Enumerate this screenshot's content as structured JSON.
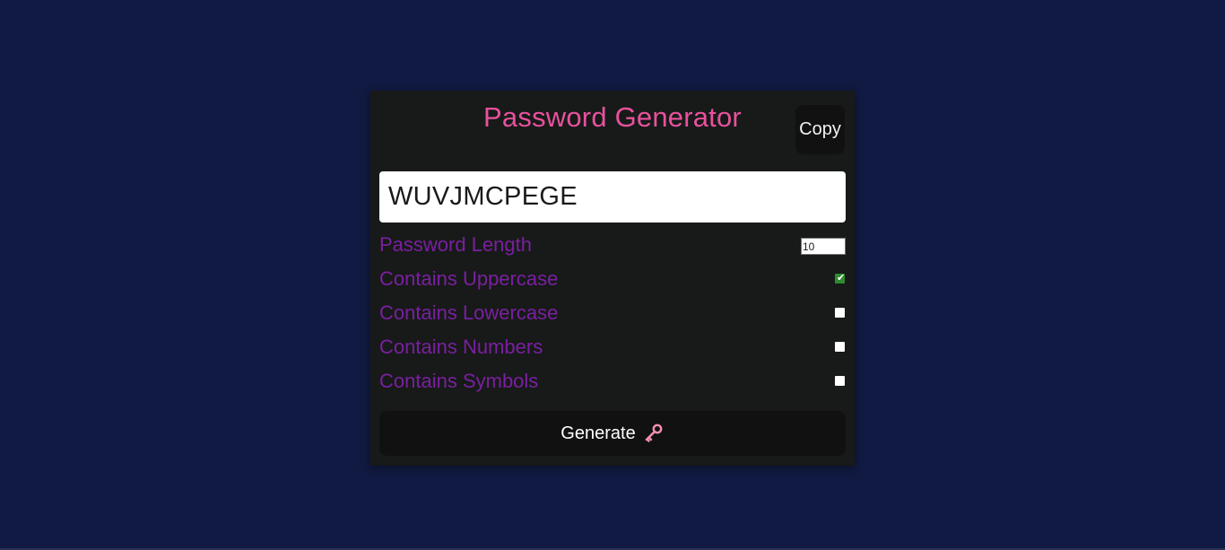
{
  "app": {
    "title": "Password Generator",
    "copy_label": "Copy"
  },
  "result": {
    "password": "WUVJMCPEGE"
  },
  "options": [
    {
      "label": "Password Length",
      "type": "number",
      "value": "10"
    },
    {
      "label": "Contains Uppercase",
      "type": "checkbox",
      "checked": true
    },
    {
      "label": "Contains Lowercase",
      "type": "checkbox",
      "checked": false
    },
    {
      "label": "Contains Numbers",
      "type": "checkbox",
      "checked": false
    },
    {
      "label": "Contains Symbols",
      "type": "checkbox",
      "checked": false
    }
  ],
  "generate": {
    "label": "Generate",
    "icon": "key-icon"
  },
  "colors": {
    "background": "#111a42",
    "card": "#171a18",
    "title": "#e8519e",
    "label": "#7b1fa2",
    "button": "#111111",
    "checkbox_checked": "#2e8b2e"
  }
}
